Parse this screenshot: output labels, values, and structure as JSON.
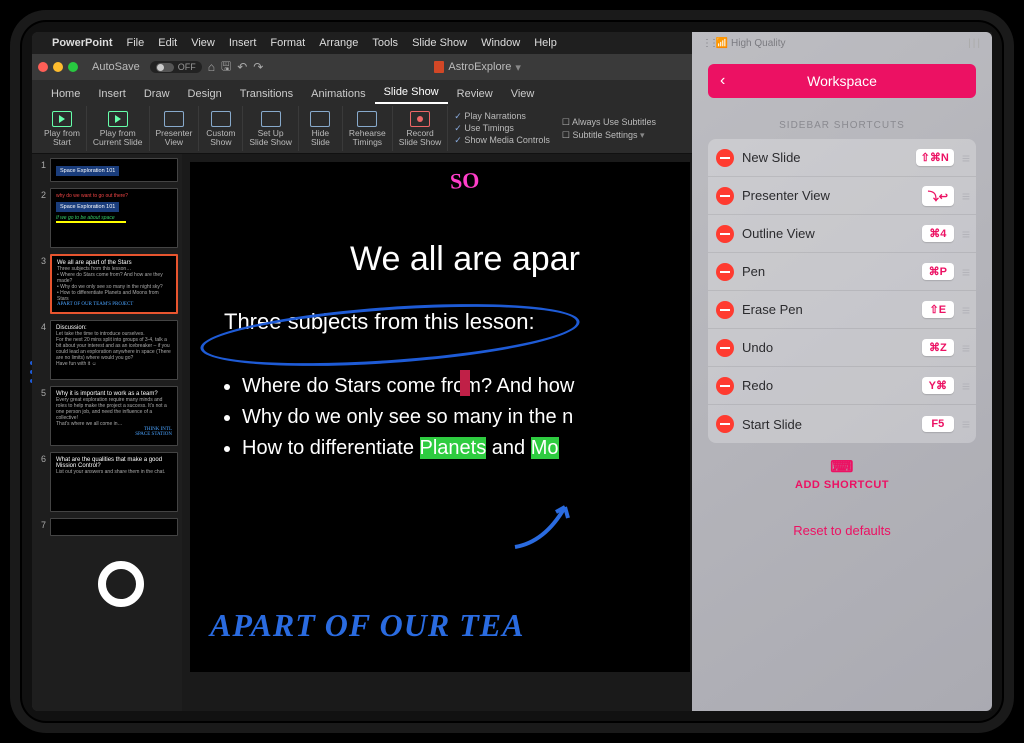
{
  "menubar": {
    "app": "PowerPoint",
    "items": [
      "File",
      "Edit",
      "View",
      "Insert",
      "Format",
      "Arrange",
      "Tools",
      "Slide Show",
      "Window",
      "Help"
    ]
  },
  "titlebar": {
    "autosave": "AutoSave",
    "autosave_state": "OFF",
    "doc": "AstroExplore",
    "caret": "▾"
  },
  "tabs": [
    "Home",
    "Insert",
    "Draw",
    "Design",
    "Transitions",
    "Animations",
    "Slide Show",
    "Review",
    "View"
  ],
  "active_tab": "Slide Show",
  "ribbon": {
    "groups": [
      {
        "label": "Play from\nStart"
      },
      {
        "label": "Play from\nCurrent Slide"
      },
      {
        "label": "Presenter\nView"
      },
      {
        "label": "Custom\nShow"
      },
      {
        "label": "Set Up\nSlide Show"
      },
      {
        "label": "Hide\nSlide"
      },
      {
        "label": "Rehearse\nTimings"
      },
      {
        "label": "Record\nSlide Show"
      }
    ],
    "checks": [
      "Play Narrations",
      "Use Timings",
      "Show Media Controls"
    ],
    "sub1": "Always Use Subtitles",
    "sub2": "Subtitle Settings"
  },
  "thumbs": [
    {
      "n": "1",
      "title": "Space Exploration 101"
    },
    {
      "n": "2",
      "title": "Space Exploration 101"
    },
    {
      "n": "3",
      "title": "We all are apart of the Stars",
      "sub": "Three subjects from this lesson…"
    },
    {
      "n": "4",
      "title": "Discussion:",
      "sub": "Let take the time to introduce ourselves."
    },
    {
      "n": "5",
      "title": "Why it is important to work as a team?"
    },
    {
      "n": "6",
      "title": "What are the qualities that make a good Mission Control?"
    },
    {
      "n": "7",
      "title": ""
    }
  ],
  "slide": {
    "pink": "SO",
    "h1": "We all are apar",
    "sub": "Three subjects from this lesson:",
    "bullets": [
      "Where do Stars come from? And how",
      "Why do we only see so many in the n",
      "How to differentiate Planets and Mo"
    ],
    "hand": "APART OF OUR TEA"
  },
  "side": {
    "quality": "High Quality",
    "workspace": "Workspace",
    "section": "SIDEBAR SHORTCUTS",
    "shortcuts": [
      {
        "label": "New Slide",
        "key": "⇧⌘N"
      },
      {
        "label": "Presenter View",
        "key": "⤵↩"
      },
      {
        "label": "Outline View",
        "key": "⌘4"
      },
      {
        "label": "Pen",
        "key": "⌘P"
      },
      {
        "label": "Erase Pen",
        "key": "⇧E"
      },
      {
        "label": "Undo",
        "key": "⌘Z"
      },
      {
        "label": "Redo",
        "key": "Y⌘"
      },
      {
        "label": "Start Slide",
        "key": "F5"
      }
    ],
    "add": "ADD SHORTCUT",
    "reset": "Reset to defaults"
  }
}
